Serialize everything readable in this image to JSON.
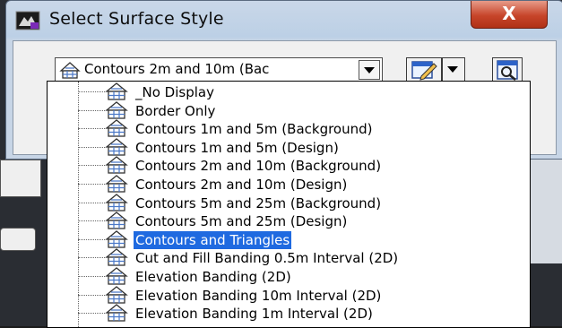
{
  "window": {
    "title": "Select Surface Style",
    "close_label": "X"
  },
  "combo": {
    "selected_value": "Contours 2m and 10m (Bac"
  },
  "dropdown": {
    "items": [
      {
        "label": "_No Display"
      },
      {
        "label": "Border Only"
      },
      {
        "label": "Contours 1m and 5m (Background)"
      },
      {
        "label": "Contours 1m and 5m (Design)"
      },
      {
        "label": "Contours 2m and 10m (Background)"
      },
      {
        "label": "Contours 2m and 10m (Design)"
      },
      {
        "label": "Contours 5m and 25m (Background)"
      },
      {
        "label": "Contours 5m and 25m (Design)"
      },
      {
        "label": "Contours and Triangles"
      },
      {
        "label": "Cut and Fill Banding 0.5m Interval (2D)"
      },
      {
        "label": "Elevation Banding (2D)"
      },
      {
        "label": "Elevation Banding 10m Interval (2D)"
      },
      {
        "label": "Elevation Banding 1m Interval (2D)"
      }
    ],
    "selected_index": 8
  },
  "colors": {
    "selection": "#1f6ae0",
    "close_button": "#c7452a",
    "title_bar": "#c9d7e8"
  },
  "icons": {
    "app": "surface-app-icon",
    "item": "surface-style-icon",
    "edit": "edit-pencil-icon",
    "view": "magnifier-view-icon"
  }
}
